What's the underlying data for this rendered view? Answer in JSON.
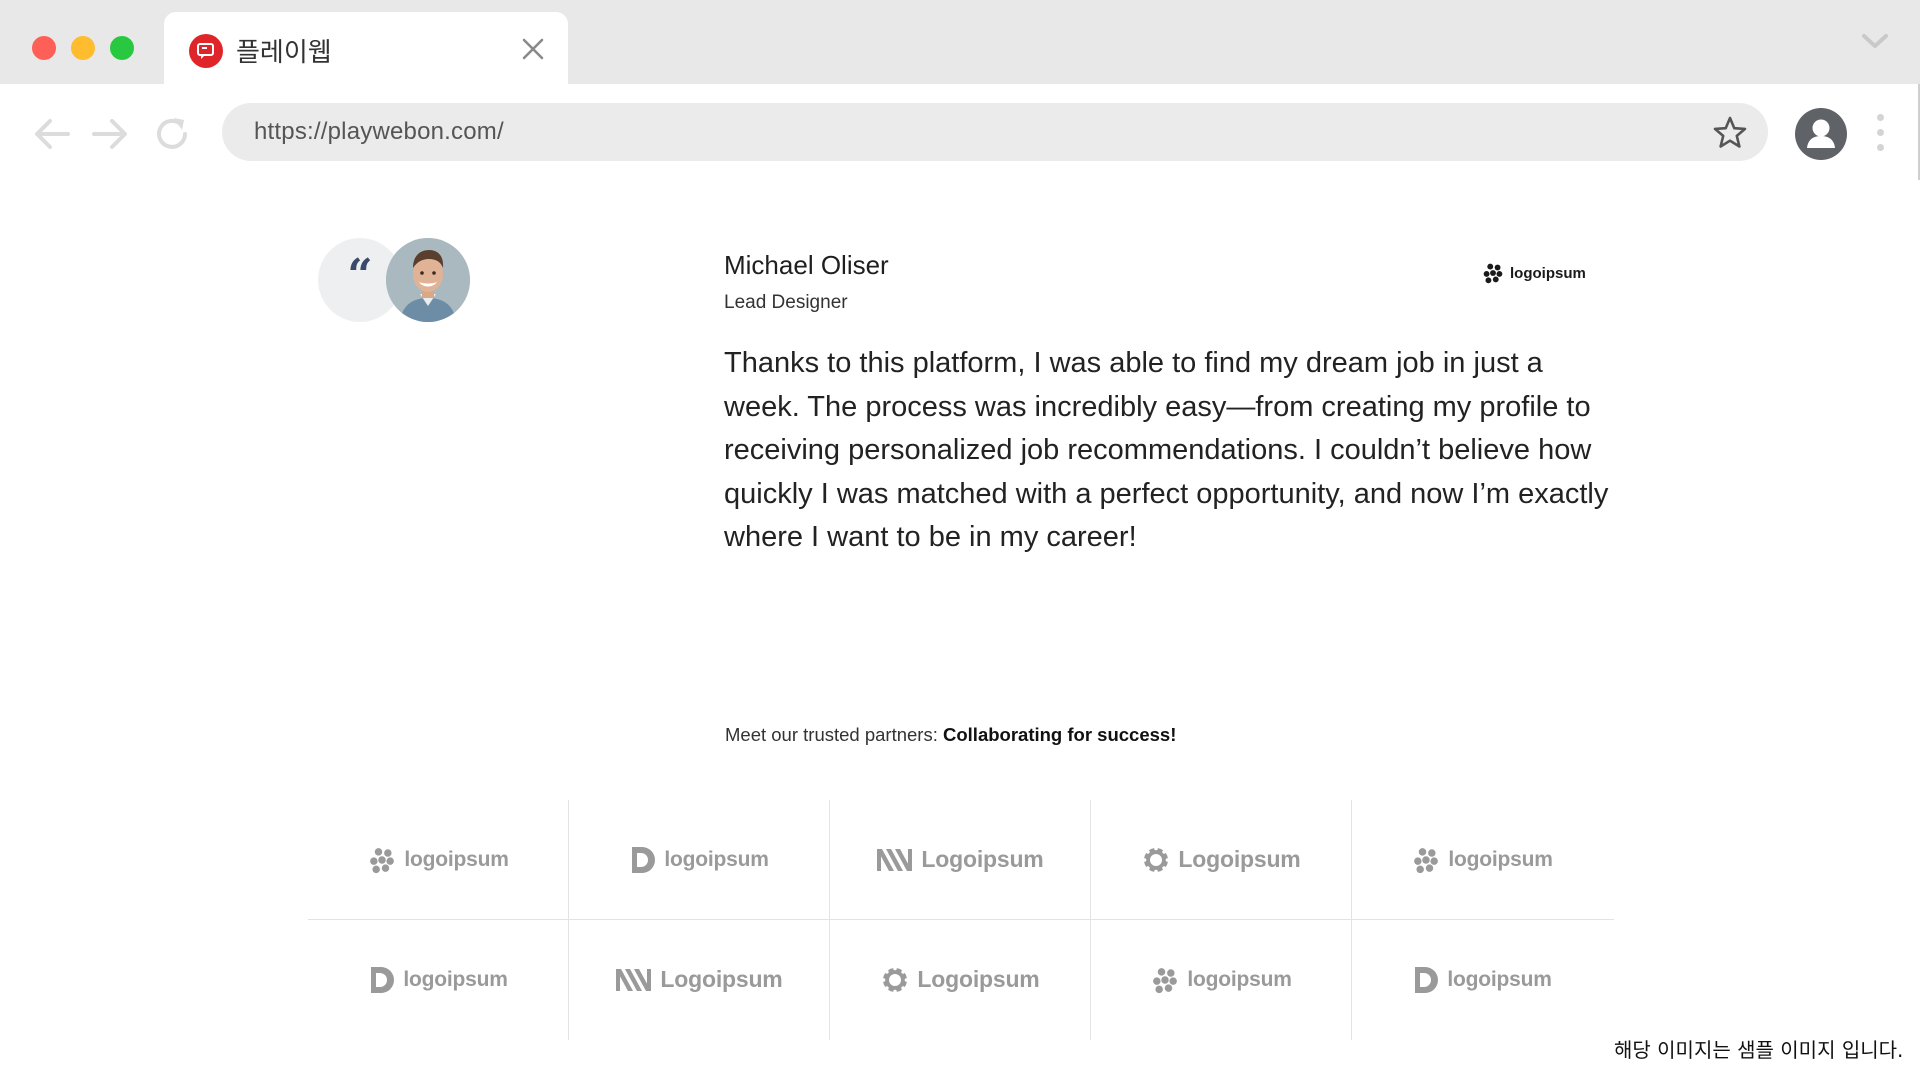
{
  "browser": {
    "tab_title": "플레이웹",
    "url": "https://playwebon.com/",
    "icons": {
      "favicon": "playwebon-logo-icon",
      "close": "close-icon",
      "tab_list": "chevron-down-icon",
      "back": "arrow-left-icon",
      "forward": "arrow-right-icon",
      "reload": "reload-icon",
      "bookmark": "star-icon",
      "profile": "user-avatar-icon",
      "menu": "more-vertical-icon"
    },
    "colors": {
      "close": "#fe5f57",
      "minimize": "#febc2e",
      "maximize": "#28c840",
      "favicon_bg": "#e0252a"
    }
  },
  "testimonial": {
    "quote_mark": "“",
    "name": "Michael Oliser",
    "role": "Lead Designer",
    "company_logo": "logoipsum",
    "text": "Thanks to this platform, I was able to find my dream job in just a week. The process was incredibly easy—from creating my profile to receiving personalized job recommendations. I couldn’t believe how quickly I was matched with a perfect opportunity, and now I’m exactly where I want to be in my career!"
  },
  "partners": {
    "intro": "Meet our trusted partners: ",
    "intro_bold": "Collaborating for success!",
    "logos": [
      {
        "text": "logoipsum",
        "icon": "clover-logo-icon"
      },
      {
        "text": "logoipsum",
        "icon": "d-shape-logo-icon"
      },
      {
        "text": "Logoipsum",
        "icon": "stripes-logo-icon"
      },
      {
        "text": "Logoipsum",
        "icon": "gear-logo-icon"
      },
      {
        "text": "logoipsum",
        "icon": "clover-logo-icon"
      },
      {
        "text": "logoipsum",
        "icon": "d-shape-logo-icon"
      },
      {
        "text": "Logoipsum",
        "icon": "stripes-logo-icon"
      },
      {
        "text": "Logoipsum",
        "icon": "gear-logo-icon"
      },
      {
        "text": "logoipsum",
        "icon": "clover-logo-icon"
      },
      {
        "text": "logoipsum",
        "icon": "d-shape-logo-icon"
      }
    ]
  },
  "footnote": "해당 이미지는 샘플 이미지 입니다."
}
